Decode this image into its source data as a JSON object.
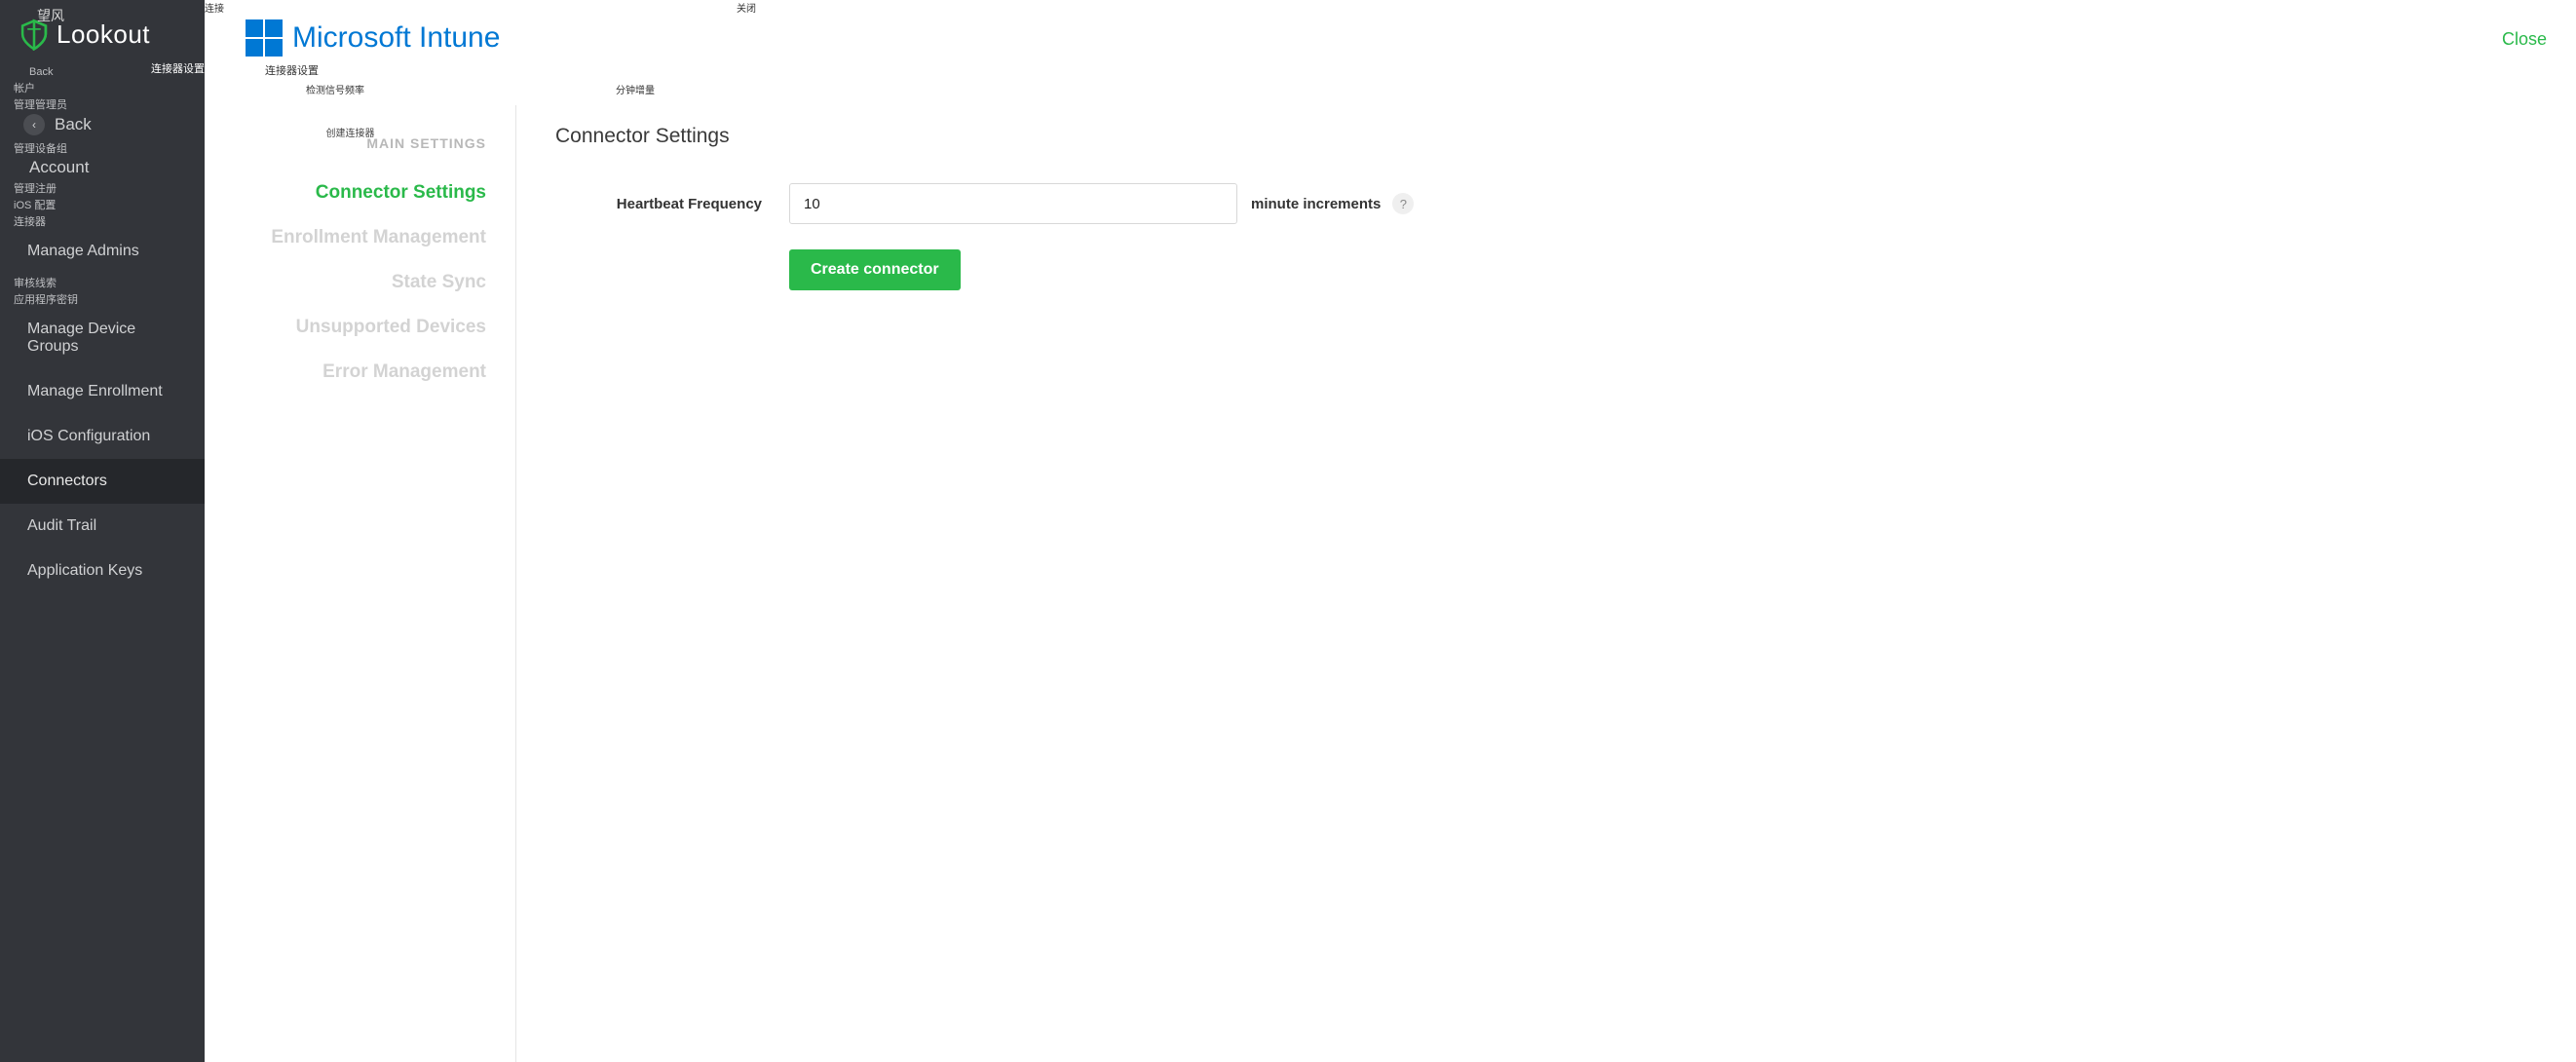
{
  "sidebar": {
    "top_small": "望风",
    "brand": "Lookout",
    "back_small": "Back",
    "account_small": "帐户",
    "admins_small": "管理管理员",
    "back_label": "Back",
    "devicegroups_small": "管理设备组",
    "account_label": "Account",
    "enrollment_small": "管理注册",
    "ios_small": "iOS 配置",
    "connectors_small": "连接器",
    "audit_small": "审核线索",
    "appkeys_small": "应用程序密钥",
    "corner_label": "连接器设置",
    "items": {
      "manage_admins": "Manage Admins",
      "manage_device_groups": "Manage Device Groups",
      "manage_enrollment": "Manage Enrollment",
      "ios_configuration": "iOS Configuration",
      "connectors": "Connectors",
      "audit_trail": "Audit Trail",
      "application_keys": "Application Keys"
    }
  },
  "topstrip": {
    "left": "连接",
    "mid": "关闭"
  },
  "header": {
    "intune": "Microsoft Intune",
    "close": "Close",
    "sub_label": "连接器设置"
  },
  "secondrow": {
    "a": "检测信号频率",
    "b": "分钟增量"
  },
  "nav": {
    "mini": "创建连接器",
    "header": "MAIN SETTINGS",
    "connector_settings": "Connector Settings",
    "enrollment_management": "Enrollment Management",
    "state_sync": "State Sync",
    "unsupported_devices": "Unsupported Devices",
    "error_management": "Error Management"
  },
  "content": {
    "title": "Connector Settings",
    "heartbeat_label": "Heartbeat Frequency",
    "heartbeat_value": "10",
    "heartbeat_suffix": "minute increments",
    "help": "?",
    "create_button": "Create connector"
  }
}
